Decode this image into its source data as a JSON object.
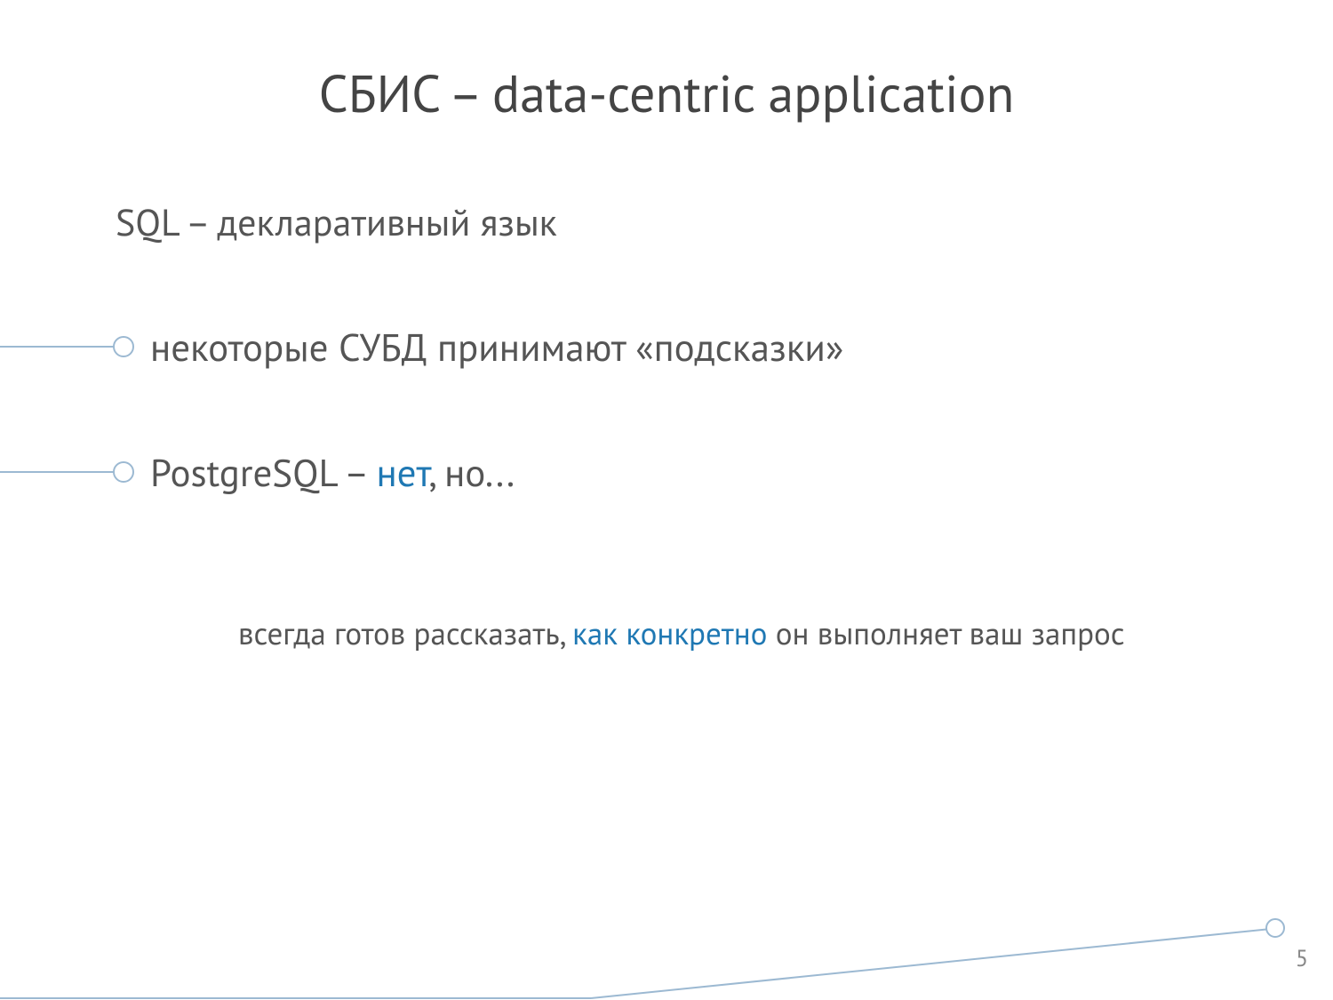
{
  "title": "СБИС – data-centric application",
  "line1": "SQL – декларативный язык",
  "bullets": [
    {
      "text": "некоторые СУБД принимают «подсказки»"
    },
    {
      "pre": "PostgreSQL – ",
      "emph": "нет",
      "post": ", но..."
    }
  ],
  "sub": {
    "pre": "всегда готов рассказать, ",
    "emph": "как конкретно",
    "post": " он выполняет ваш запрос"
  },
  "page_number": "5",
  "colors": {
    "accent": "#1f78b3",
    "line": "#9cb9d2",
    "text": "#555555"
  }
}
